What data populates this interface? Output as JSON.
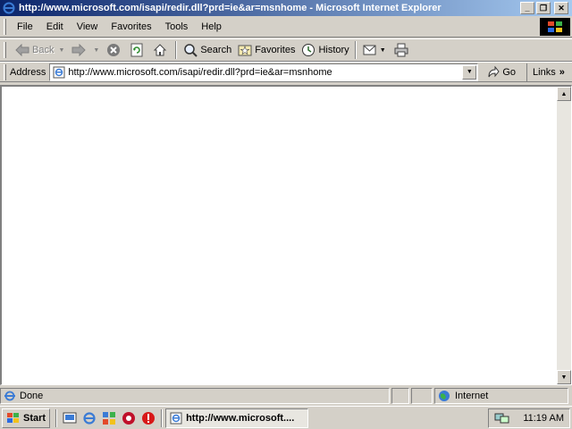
{
  "window": {
    "title": "http://www.microsoft.com/isapi/redir.dll?prd=ie&ar=msnhome - Microsoft Internet Explorer",
    "app_icon": "ie-icon",
    "controls": {
      "minimize": "_",
      "maximize": "❐",
      "close": "✕"
    }
  },
  "menubar": {
    "items": [
      {
        "label": "File"
      },
      {
        "label": "Edit"
      },
      {
        "label": "View"
      },
      {
        "label": "Favorites"
      },
      {
        "label": "Tools"
      },
      {
        "label": "Help"
      }
    ]
  },
  "toolbar": {
    "back_label": "Back",
    "search_label": "Search",
    "favorites_label": "Favorites",
    "history_label": "History"
  },
  "address": {
    "label": "Address",
    "url": "http://www.microsoft.com/isapi/redir.dll?prd=ie&ar=msnhome",
    "go_label": "Go",
    "links_label": "Links",
    "links_arrow": "»"
  },
  "status": {
    "text": "Done",
    "zone": "Internet"
  },
  "taskbar": {
    "start_label": "Start",
    "task_label": "http://www.microsoft....",
    "clock": "11:19 AM"
  },
  "colors": {
    "title_start": "#0a246a",
    "title_end": "#a6caf0",
    "chrome": "#d4d0c8",
    "content_bg": "#ffffff"
  }
}
